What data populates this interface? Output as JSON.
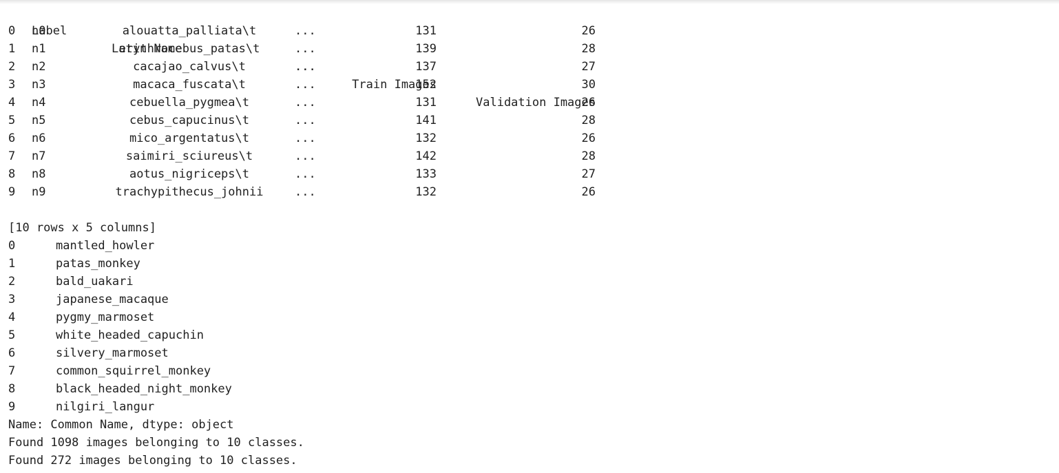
{
  "dataframe": {
    "headers": {
      "label": "Label",
      "latin": "Latin Name",
      "ellipsis": "...",
      "train": "Train Images",
      "validation": "Validation Images"
    },
    "rows": [
      {
        "idx": "0",
        "label": "n0",
        "latin": "alouatta_palliata\\t",
        "ellipsis": "...",
        "train": "131",
        "validation": "26"
      },
      {
        "idx": "1",
        "label": "n1",
        "latin": "erythrocebus_patas\\t",
        "ellipsis": "...",
        "train": "139",
        "validation": "28"
      },
      {
        "idx": "2",
        "label": "n2",
        "latin": "cacajao_calvus\\t",
        "ellipsis": "...",
        "train": "137",
        "validation": "27"
      },
      {
        "idx": "3",
        "label": "n3",
        "latin": "macaca_fuscata\\t",
        "ellipsis": "...",
        "train": "152",
        "validation": "30"
      },
      {
        "idx": "4",
        "label": "n4",
        "latin": "cebuella_pygmea\\t",
        "ellipsis": "...",
        "train": "131",
        "validation": "26"
      },
      {
        "idx": "5",
        "label": "n5",
        "latin": "cebus_capucinus\\t",
        "ellipsis": "...",
        "train": "141",
        "validation": "28"
      },
      {
        "idx": "6",
        "label": "n6",
        "latin": "mico_argentatus\\t",
        "ellipsis": "...",
        "train": "132",
        "validation": "26"
      },
      {
        "idx": "7",
        "label": "n7",
        "latin": "saimiri_sciureus\\t",
        "ellipsis": "...",
        "train": "142",
        "validation": "28"
      },
      {
        "idx": "8",
        "label": "n8",
        "latin": "aotus_nigriceps\\t",
        "ellipsis": "...",
        "train": "133",
        "validation": "27"
      },
      {
        "idx": "9",
        "label": "n9",
        "latin": "trachypithecus_johnii",
        "ellipsis": "...",
        "train": "132",
        "validation": "26"
      }
    ],
    "shape_text": "[10 rows x 5 columns]"
  },
  "series": {
    "rows": [
      {
        "idx": "0",
        "value": "mantled_howler"
      },
      {
        "idx": "1",
        "value": "patas_monkey"
      },
      {
        "idx": "2",
        "value": "bald_uakari"
      },
      {
        "idx": "3",
        "value": "japanese_macaque"
      },
      {
        "idx": "4",
        "value": "pygmy_marmoset"
      },
      {
        "idx": "5",
        "value": "white_headed_capuchin"
      },
      {
        "idx": "6",
        "value": "silvery_marmoset"
      },
      {
        "idx": "7",
        "value": "common_squirrel_monkey"
      },
      {
        "idx": "8",
        "value": "black_headed_night_monkey"
      },
      {
        "idx": "9",
        "value": "nilgiri_langur"
      }
    ],
    "footer": "Name: Common Name, dtype: object"
  },
  "messages": [
    "Found 1098 images belonging to 10 classes.",
    "Found 272 images belonging to 10 classes."
  ]
}
